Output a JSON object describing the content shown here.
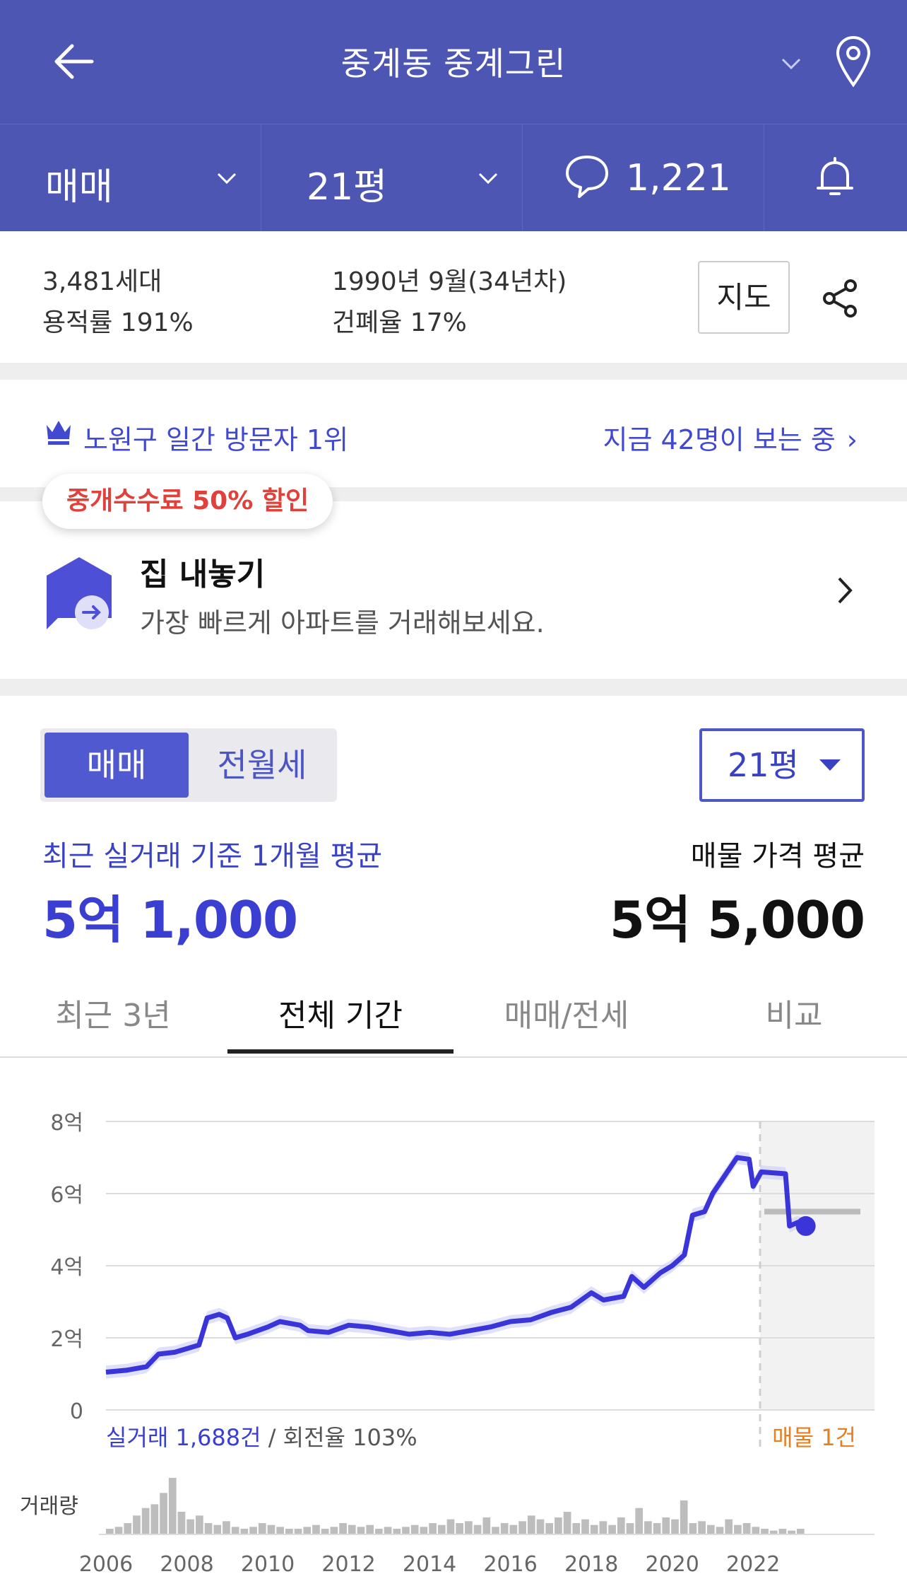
{
  "header": {
    "title": "중계동 중계그린"
  },
  "filters": {
    "trade_type": "매매",
    "size": "21평",
    "comment_count": "1,221"
  },
  "info": {
    "households": "3,481세대",
    "far": "용적률 191%",
    "built": "1990년 9월(34년차)",
    "bcr": "건폐율 17%",
    "map_button": "지도"
  },
  "rank": {
    "text": "노원구 일간 방문자 1위",
    "viewers": "지금 42명이 보는 중"
  },
  "sell": {
    "badge": "중개수수료 50% 할인",
    "title": "집 내놓기",
    "subtitle": "가장 빠르게 아파트를 거래해보세요."
  },
  "segment": {
    "active": "매매",
    "inactive": "전월세"
  },
  "size_select": "21평",
  "averages": {
    "recent_label": "최근 실거래 기준 1개월 평균",
    "recent_value": "5억 1,000",
    "listing_label": "매물 가격 평균",
    "listing_value": "5억 5,000"
  },
  "period_tabs": [
    "최근 3년",
    "전체 기간",
    "매매/전세",
    "비교"
  ],
  "active_tab_index": 1,
  "colors": {
    "brand": "#4d57b3",
    "accent": "#3a3fd1",
    "listing": "#e67e22",
    "badge": "#e0413a"
  },
  "chart_data": {
    "type": "line",
    "y_tick_labels": [
      "0",
      "2억",
      "4억",
      "6억",
      "8억"
    ],
    "ylim": [
      0,
      8
    ],
    "x_tick_labels": [
      "2006",
      "2008",
      "2010",
      "2012",
      "2014",
      "2016",
      "2018",
      "2020",
      "2022"
    ],
    "xlim": [
      2006,
      2025
    ],
    "summary_prefix": "실거래 1,688건",
    "summary_suffix": " / 회전율 103%",
    "listing_label": "매물 1건",
    "volume_label": "거래량",
    "price_series": [
      [
        2006.0,
        1.05
      ],
      [
        2006.5,
        1.1
      ],
      [
        2007.0,
        1.2
      ],
      [
        2007.3,
        1.55
      ],
      [
        2007.7,
        1.6
      ],
      [
        2008.0,
        1.7
      ],
      [
        2008.3,
        1.8
      ],
      [
        2008.5,
        2.55
      ],
      [
        2008.8,
        2.65
      ],
      [
        2009.0,
        2.55
      ],
      [
        2009.2,
        2.0
      ],
      [
        2009.5,
        2.1
      ],
      [
        2010.0,
        2.3
      ],
      [
        2010.3,
        2.45
      ],
      [
        2010.8,
        2.35
      ],
      [
        2011.0,
        2.2
      ],
      [
        2011.5,
        2.15
      ],
      [
        2012.0,
        2.35
      ],
      [
        2012.5,
        2.3
      ],
      [
        2013.0,
        2.2
      ],
      [
        2013.5,
        2.1
      ],
      [
        2014.0,
        2.15
      ],
      [
        2014.5,
        2.1
      ],
      [
        2015.0,
        2.2
      ],
      [
        2015.5,
        2.3
      ],
      [
        2016.0,
        2.45
      ],
      [
        2016.5,
        2.5
      ],
      [
        2017.0,
        2.7
      ],
      [
        2017.5,
        2.85
      ],
      [
        2018.0,
        3.25
      ],
      [
        2018.3,
        3.05
      ],
      [
        2018.8,
        3.15
      ],
      [
        2019.0,
        3.7
      ],
      [
        2019.3,
        3.4
      ],
      [
        2019.7,
        3.8
      ],
      [
        2020.0,
        4.0
      ],
      [
        2020.3,
        4.3
      ],
      [
        2020.5,
        5.4
      ],
      [
        2020.8,
        5.5
      ],
      [
        2021.0,
        6.0
      ],
      [
        2021.3,
        6.5
      ],
      [
        2021.6,
        7.0
      ],
      [
        2021.9,
        6.95
      ],
      [
        2022.0,
        6.2
      ],
      [
        2022.2,
        6.6
      ],
      [
        2022.8,
        6.55
      ],
      [
        2022.9,
        5.1
      ],
      [
        2023.1,
        5.2
      ],
      [
        2023.3,
        5.1
      ]
    ],
    "listing_price": 5.5,
    "volume": [
      3,
      4,
      6,
      10,
      14,
      16,
      22,
      30,
      12,
      8,
      10,
      6,
      5,
      7,
      4,
      3,
      4,
      6,
      5,
      4,
      3,
      3,
      4,
      5,
      3,
      4,
      6,
      5,
      4,
      5,
      3,
      4,
      3,
      4,
      5,
      4,
      6,
      5,
      8,
      6,
      7,
      5,
      9,
      4,
      6,
      5,
      7,
      10,
      8,
      6,
      9,
      12,
      6,
      8,
      5,
      7,
      5,
      9,
      6,
      14,
      7,
      6,
      9,
      8,
      18,
      6,
      7,
      5,
      4,
      8,
      5,
      6,
      4,
      3,
      2,
      3,
      2,
      3
    ]
  }
}
